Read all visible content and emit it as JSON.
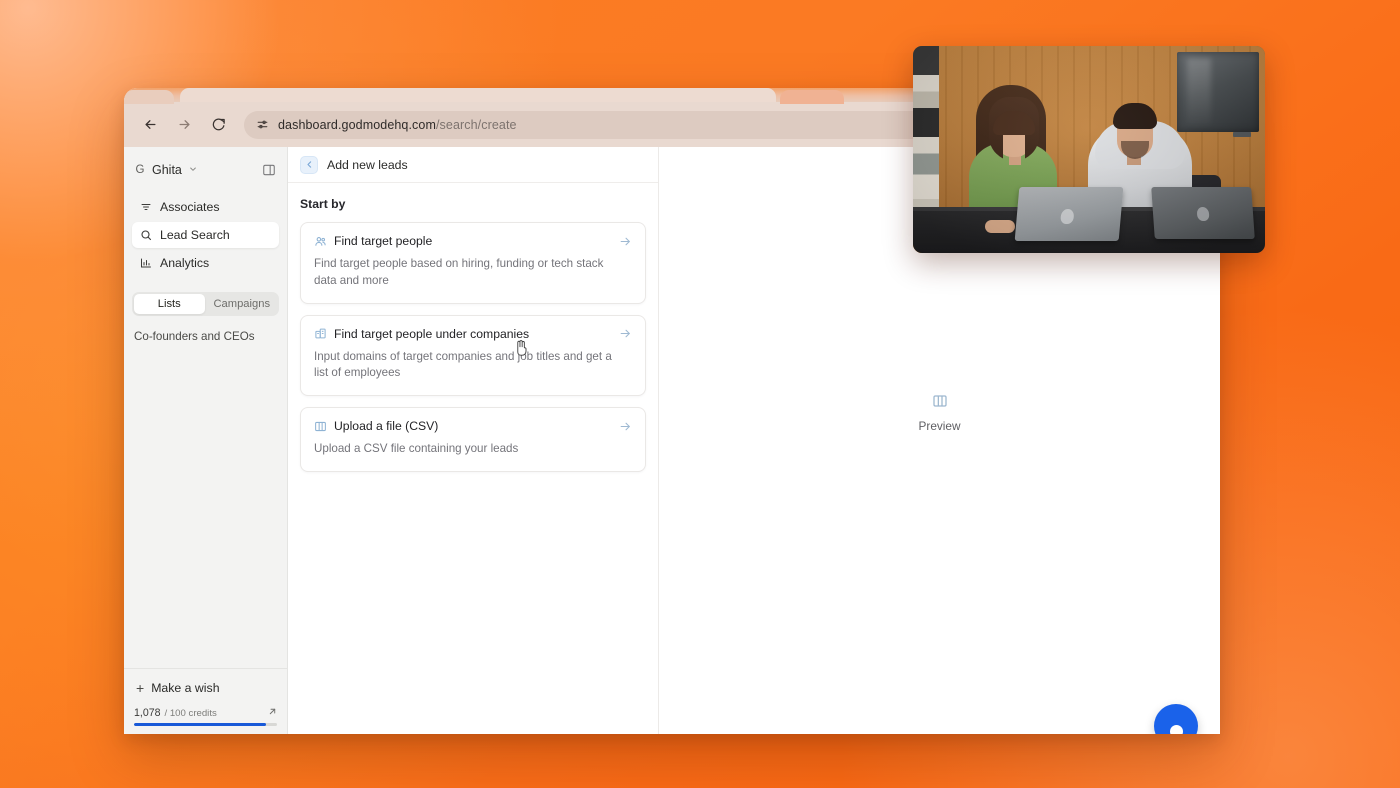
{
  "browser": {
    "url_host": "dashboard.godmodehq.com",
    "url_path": "/search/create",
    "back_icon": "back-arrow-icon",
    "forward_icon": "forward-arrow-icon",
    "reload_icon": "reload-icon",
    "site_settings_icon": "site-settings-icon",
    "hide_icon": "eye-slash-icon",
    "bookmark_icon": "star-icon"
  },
  "sidebar": {
    "workspace_initial": "G",
    "workspace_name": "Ghita",
    "workspace_chevron": "chevron-down-icon",
    "panel_toggle_icon": "panel-collapse-icon",
    "nav_items": [
      {
        "label": "Associates",
        "icon": "filter-icon",
        "active": false
      },
      {
        "label": "Lead Search",
        "icon": "search-icon",
        "active": true
      },
      {
        "label": "Analytics",
        "icon": "bar-chart-icon",
        "active": false
      }
    ],
    "segments": [
      {
        "label": "Lists",
        "active": true
      },
      {
        "label": "Campaigns",
        "active": false
      }
    ],
    "list_entry": "Co-founders and CEOs",
    "make_a_wish": "Make a wish",
    "credits_used": "1,078",
    "credits_separator": "/ 100 credits",
    "credits_external_icon": "external-link-icon",
    "credits_progress_percent": 92
  },
  "center": {
    "back_icon": "back-chevron-icon",
    "title": "Add new leads",
    "section_label": "Start by",
    "options": [
      {
        "icon": "people-icon",
        "title": "Find target people",
        "description": "Find target people based on hiring, funding or tech stack data and more",
        "arrow_icon": "arrow-right-icon"
      },
      {
        "icon": "building-icon",
        "title": "Find target people under companies",
        "description": "Input domains of target companies and job titles and get a list of employees",
        "arrow_icon": "arrow-right-icon"
      },
      {
        "icon": "columns-icon",
        "title": "Upload a file (CSV)",
        "description": "Upload a CSV file containing your leads",
        "arrow_icon": "arrow-right-icon"
      }
    ]
  },
  "preview": {
    "icon": "panel-preview-icon",
    "label": "Preview"
  },
  "chat_widget": {
    "icon": "chat-bubble-icon"
  },
  "cursor": {
    "icon": "pointer-hand-cursor"
  },
  "colors": {
    "background_orange": "#fb7d22",
    "accent_blue": "#1859d8",
    "chat_blue": "#1a62ea",
    "toolbar_tan": "#e9d9d0",
    "sidebar_gray": "#f3f3f2"
  },
  "video_overlay": {
    "description": "Two people working at laptops in a wood-paneled office"
  }
}
